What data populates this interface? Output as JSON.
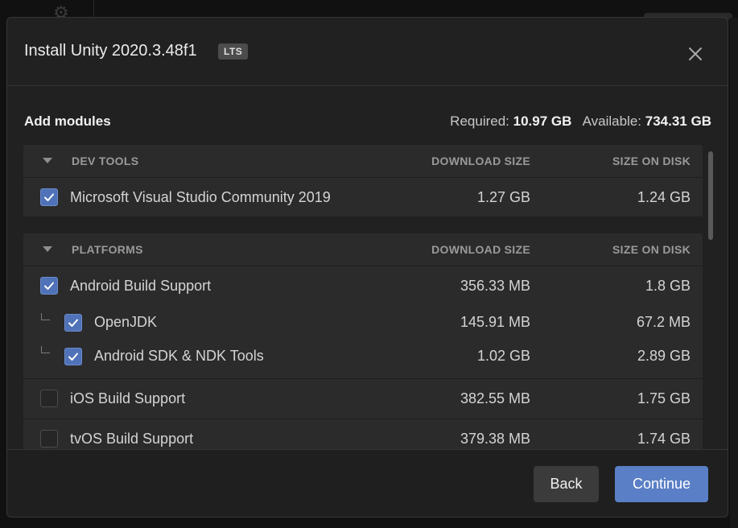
{
  "dialog": {
    "title": "Install Unity 2020.3.48f1",
    "badge": "LTS"
  },
  "modules": {
    "heading": "Add modules",
    "required_label": "Required:",
    "required_value": "10.97 GB",
    "available_label": "Available:",
    "available_value": "734.31 GB"
  },
  "sections": {
    "dev_tools": {
      "name": "DEV TOOLS",
      "col_download": "DOWNLOAD SIZE",
      "col_disk": "SIZE ON DISK",
      "rows": [
        {
          "name": "Microsoft Visual Studio Community 2019",
          "download": "1.27 GB",
          "disk": "1.24 GB",
          "checked": true
        }
      ]
    },
    "platforms": {
      "name": "PLATFORMS",
      "col_download": "DOWNLOAD SIZE",
      "col_disk": "SIZE ON DISK",
      "rows": [
        {
          "name": "Android Build Support",
          "download": "356.33 MB",
          "disk": "1.8 GB",
          "checked": true
        },
        {
          "name": "OpenJDK",
          "download": "145.91 MB",
          "disk": "67.2 MB",
          "checked": true
        },
        {
          "name": "Android SDK & NDK Tools",
          "download": "1.02 GB",
          "disk": "2.89 GB",
          "checked": true
        },
        {
          "name": "iOS Build Support",
          "download": "382.55 MB",
          "disk": "1.75 GB",
          "checked": false
        },
        {
          "name": "tvOS Build Support",
          "download": "379.38 MB",
          "disk": "1.74 GB",
          "checked": false
        }
      ]
    }
  },
  "footer": {
    "back_label": "Back",
    "continue_label": "Continue"
  },
  "colors": {
    "accent": "#5a7fc6",
    "checkbox_checked": "#4f72b8",
    "panel": "#2b2b2b",
    "dialog": "#212121"
  },
  "icons": [
    "close-icon",
    "check-icon",
    "caret-down-icon",
    "gear-icon"
  ]
}
